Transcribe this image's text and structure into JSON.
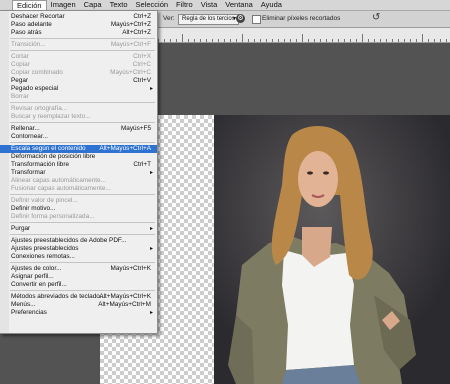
{
  "menubar": [
    "Edición",
    "Imagen",
    "Capa",
    "Texto",
    "Selección",
    "Filtro",
    "Vista",
    "Ventana",
    "Ayuda"
  ],
  "options": {
    "ver_label": "Ver:",
    "view_select": "Regla de los tercios",
    "delete_cropped_label": "Eliminar píxeles recortados",
    "reset_glyph": "↺"
  },
  "menu": {
    "items": [
      {
        "label": "Deshacer Recortar",
        "shortcut": "Ctrl+Z",
        "disabled": false
      },
      {
        "label": "Paso adelante",
        "shortcut": "Mayús+Ctrl+Z",
        "disabled": false
      },
      {
        "label": "Paso atrás",
        "shortcut": "Alt+Ctrl+Z",
        "disabled": false
      },
      {
        "label": "Transición...",
        "shortcut": "Mayús+Ctrl+F",
        "disabled": true
      },
      {
        "label": "Cortar",
        "shortcut": "Ctrl+X",
        "disabled": true
      },
      {
        "label": "Copiar",
        "shortcut": "Ctrl+C",
        "disabled": true
      },
      {
        "label": "Copiar combinado",
        "shortcut": "Mayús+Ctrl+C",
        "disabled": true
      },
      {
        "label": "Pegar",
        "shortcut": "Ctrl+V",
        "disabled": false
      },
      {
        "label": "Pegado especial",
        "shortcut": "",
        "disabled": false,
        "submenu": true
      },
      {
        "label": "Borrar",
        "shortcut": "",
        "disabled": true
      },
      {
        "label": "Revisar ortografía...",
        "shortcut": "",
        "disabled": true
      },
      {
        "label": "Buscar y reemplazar texto...",
        "shortcut": "",
        "disabled": true
      },
      {
        "label": "Rellenar...",
        "shortcut": "Mayús+F5",
        "disabled": false
      },
      {
        "label": "Contornear...",
        "shortcut": "",
        "disabled": false
      },
      {
        "label": "Escala según el contenido",
        "shortcut": "Alt+Mayús+Ctrl+A",
        "disabled": false,
        "highlighted": true
      },
      {
        "label": "Deformación de posición libre",
        "shortcut": "",
        "disabled": false
      },
      {
        "label": "Transformación libre",
        "shortcut": "Ctrl+T",
        "disabled": false
      },
      {
        "label": "Transformar",
        "shortcut": "",
        "disabled": false,
        "submenu": true
      },
      {
        "label": "Alinear capas automáticamente...",
        "shortcut": "",
        "disabled": true
      },
      {
        "label": "Fusionar capas automáticamente...",
        "shortcut": "",
        "disabled": true
      },
      {
        "label": "Definir valor de pincel...",
        "shortcut": "",
        "disabled": true
      },
      {
        "label": "Definir motivo...",
        "shortcut": "",
        "disabled": false
      },
      {
        "label": "Definir forma personalizada...",
        "shortcut": "",
        "disabled": true
      },
      {
        "label": "Purgar",
        "shortcut": "",
        "disabled": false,
        "submenu": true
      },
      {
        "label": "Ajustes preestablecidos de Adobe PDF...",
        "shortcut": "",
        "disabled": false
      },
      {
        "label": "Ajustes preestablecidos",
        "shortcut": "",
        "disabled": false,
        "submenu": true
      },
      {
        "label": "Conexiones remotas...",
        "shortcut": "",
        "disabled": false
      },
      {
        "label": "Ajustes de color...",
        "shortcut": "Mayús+Ctrl+K",
        "disabled": false
      },
      {
        "label": "Asignar perfil...",
        "shortcut": "",
        "disabled": false
      },
      {
        "label": "Convertir en perfil...",
        "shortcut": "",
        "disabled": false
      },
      {
        "label": "Métodos abreviados de teclado...",
        "shortcut": "Alt+Mayús+Ctrl+K",
        "disabled": false
      },
      {
        "label": "Menús...",
        "shortcut": "Alt+Mayús+Ctrl+M",
        "disabled": false
      },
      {
        "label": "Preferencias",
        "shortcut": "",
        "disabled": false,
        "submenu": true
      }
    ]
  },
  "colors": {
    "highlight": "#2e72d2",
    "menu_bg": "#efefef",
    "canvas_bg": "#535353",
    "photo_bg": "#3e3c40",
    "jacket": "#7d7b62",
    "hair": "#b98848"
  },
  "icons": {
    "submenu_arrow": "▸",
    "view_dropdown": "▾",
    "gear": "⚙"
  }
}
